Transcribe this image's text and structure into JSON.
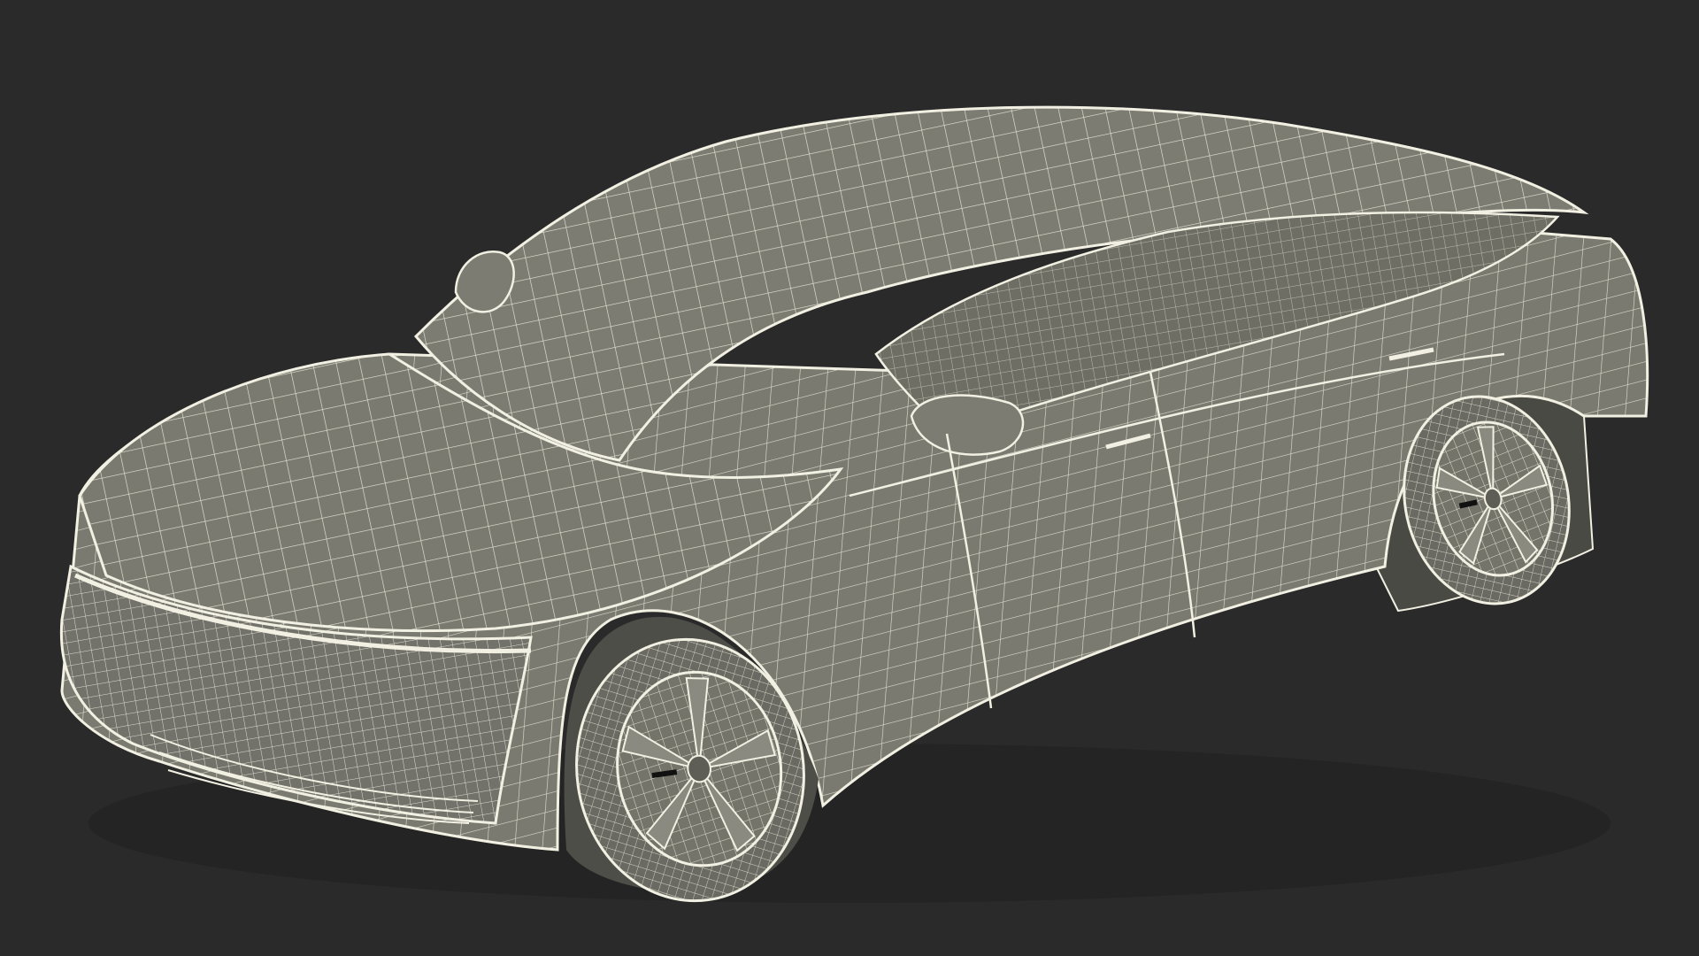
{
  "scene": {
    "background_color": "#2a2a2a",
    "surface_color": "#7a7a70",
    "surface_dark_color": "#5e5e56",
    "wire_color": "#f2f0e2",
    "subject": "sedan-wireframe-render",
    "view": "front-left-three-quarter",
    "wheel_spoke_count": 5
  }
}
